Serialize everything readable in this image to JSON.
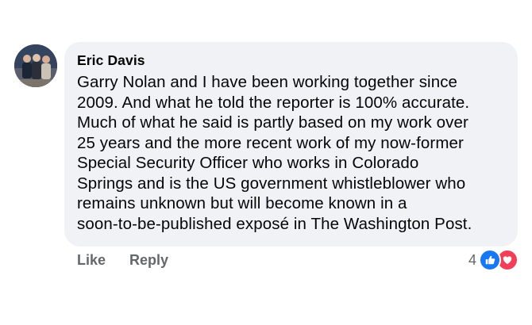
{
  "comment": {
    "author": "Eric Davis",
    "lines": [
      "Garry Nolan and I have been working together since",
      "2009. And what he told the reporter is 100% accurate.",
      "Much of what he said is partly based on my work over",
      "25 years and the more recent work of my now-former",
      "Special Security Officer who works in Colorado",
      "Springs and is the US government whistleblower who",
      "remains unknown but will become known in a",
      "soon-to-be-published exposé in The Washington Post."
    ]
  },
  "actions": {
    "like_label": "Like",
    "reply_label": "Reply"
  },
  "reactions": {
    "count": "4",
    "icons": [
      "like-icon",
      "love-icon"
    ]
  },
  "colors": {
    "bubble": "#f0f2f5",
    "secondary_text": "#65676b",
    "like_blue": "#1877f2",
    "love_red": "#f33e58"
  }
}
